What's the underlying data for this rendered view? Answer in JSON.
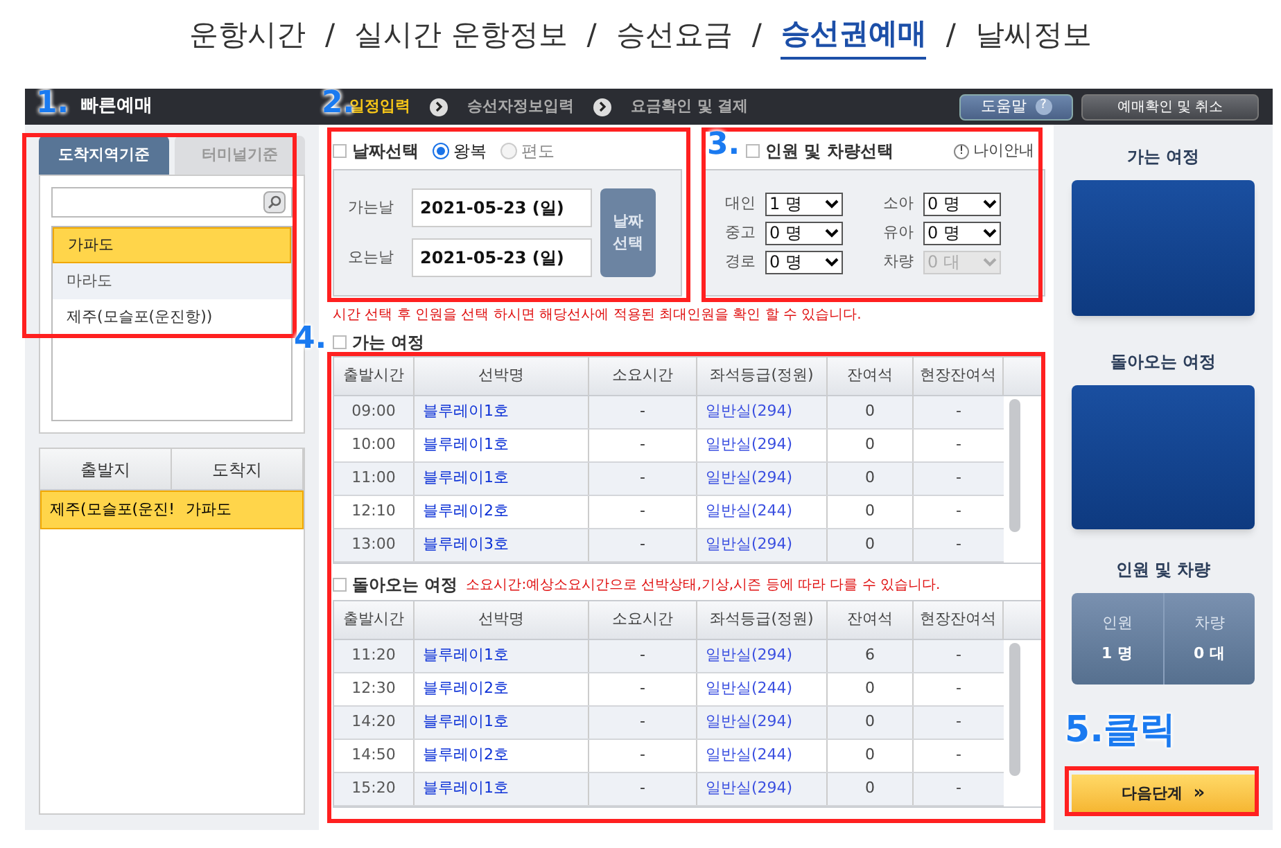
{
  "top_nav": {
    "separator": "/",
    "items": [
      {
        "label": "운항시간",
        "selected": false
      },
      {
        "label": "실시간 운항정보",
        "selected": false
      },
      {
        "label": "승선요금",
        "selected": false
      },
      {
        "label": "승선권예매",
        "selected": true
      },
      {
        "label": "날씨정보",
        "selected": false
      }
    ]
  },
  "header": {
    "title": "빠른예매",
    "steps": [
      {
        "label": "일정입력",
        "selected": true
      },
      {
        "label": "승선자정보입력",
        "selected": false
      },
      {
        "label": "요금확인 및 결제",
        "selected": false
      }
    ],
    "help_button": "도움말",
    "help_icon": "?",
    "confirm_button": "예매확인 및 취소"
  },
  "destination": {
    "tabs": [
      {
        "label": "도착지역기준",
        "selected": true
      },
      {
        "label": "터미널기준",
        "selected": false
      }
    ],
    "items": [
      {
        "label": "가파도",
        "selected": true
      },
      {
        "label": "마라도",
        "selected": false
      },
      {
        "label": "제주(모슬포(운진항))",
        "selected": false
      }
    ]
  },
  "route": {
    "columns": [
      "출발지",
      "도착지"
    ],
    "rows": [
      {
        "from": "제주(모슬포(운진!",
        "to": "가파도",
        "selected": true
      }
    ]
  },
  "date_select": {
    "title": "날짜선택",
    "trip_types": [
      {
        "label": "왕복",
        "selected": true
      },
      {
        "label": "편도",
        "selected": false
      }
    ],
    "dates": [
      {
        "label": "가는날",
        "value": "2021-05-23 (일)"
      },
      {
        "label": "오는날",
        "value": "2021-05-23 (일)"
      }
    ],
    "button": "날짜 선택"
  },
  "passengers": {
    "title": "인원 및 차량선택",
    "age_info": "나이안내",
    "age_icon": "!",
    "fields": [
      {
        "label": "대인",
        "value": "1 명",
        "disabled": false
      },
      {
        "label": "소아",
        "value": "0 명",
        "disabled": false
      },
      {
        "label": "중고",
        "value": "0 명",
        "disabled": false
      },
      {
        "label": "유아",
        "value": "0 명",
        "disabled": false
      },
      {
        "label": "경로",
        "value": "0 명",
        "disabled": false
      },
      {
        "label": "차량",
        "value": "0 대",
        "disabled": true
      }
    ]
  },
  "notice": "시간 선택 후 인원을 선택 하시면 해당선사에 적용된 최대인원을 확인 할 수 있습니다.",
  "outbound": {
    "title": "가는 여정",
    "columns": [
      "출발시간",
      "선박명",
      "소요시간",
      "좌석등급(정원)",
      "잔여석",
      "현장잔여석"
    ],
    "rows": [
      {
        "time": "09:00",
        "ship": "블루레이1호",
        "duration": "-",
        "seat": "일반실(294)",
        "remaining": "0",
        "onsite": "-"
      },
      {
        "time": "10:00",
        "ship": "블루레이1호",
        "duration": "-",
        "seat": "일반실(294)",
        "remaining": "0",
        "onsite": "-"
      },
      {
        "time": "11:00",
        "ship": "블루레이1호",
        "duration": "-",
        "seat": "일반실(294)",
        "remaining": "0",
        "onsite": "-"
      },
      {
        "time": "12:10",
        "ship": "블루레이2호",
        "duration": "-",
        "seat": "일반실(244)",
        "remaining": "0",
        "onsite": "-"
      },
      {
        "time": "13:00",
        "ship": "블루레이3호",
        "duration": "-",
        "seat": "일반실(294)",
        "remaining": "0",
        "onsite": "-"
      }
    ]
  },
  "return": {
    "title": "돌아오는 여정",
    "note": "소요시간:예상소요시간으로 선박상태,기상,시즌 등에 따라 다를 수 있습니다.",
    "columns": [
      "출발시간",
      "선박명",
      "소요시간",
      "좌석등급(정원)",
      "잔여석",
      "현장잔여석"
    ],
    "rows": [
      {
        "time": "11:20",
        "ship": "블루레이1호",
        "duration": "-",
        "seat": "일반실(294)",
        "remaining": "6",
        "onsite": "-"
      },
      {
        "time": "12:30",
        "ship": "블루레이2호",
        "duration": "-",
        "seat": "일반실(244)",
        "remaining": "0",
        "onsite": "-"
      },
      {
        "time": "14:20",
        "ship": "블루레이1호",
        "duration": "-",
        "seat": "일반실(294)",
        "remaining": "0",
        "onsite": "-"
      },
      {
        "time": "14:50",
        "ship": "블루레이2호",
        "duration": "-",
        "seat": "일반실(244)",
        "remaining": "0",
        "onsite": "-"
      },
      {
        "time": "15:20",
        "ship": "블루레이1호",
        "duration": "-",
        "seat": "일반실(294)",
        "remaining": "0",
        "onsite": "-"
      }
    ]
  },
  "summary": {
    "outbound_title": "가는 여정",
    "return_title": "돌아오는 여정",
    "counts_title": "인원 및 차량",
    "counts": [
      {
        "label": "인원",
        "value": "1 명"
      },
      {
        "label": "차량",
        "value": "0 대"
      }
    ],
    "next_button": "다음단계",
    "next_icon": "»"
  },
  "annotations": [
    "1.",
    "2.",
    "3.",
    "4.",
    "5.클릭"
  ]
}
